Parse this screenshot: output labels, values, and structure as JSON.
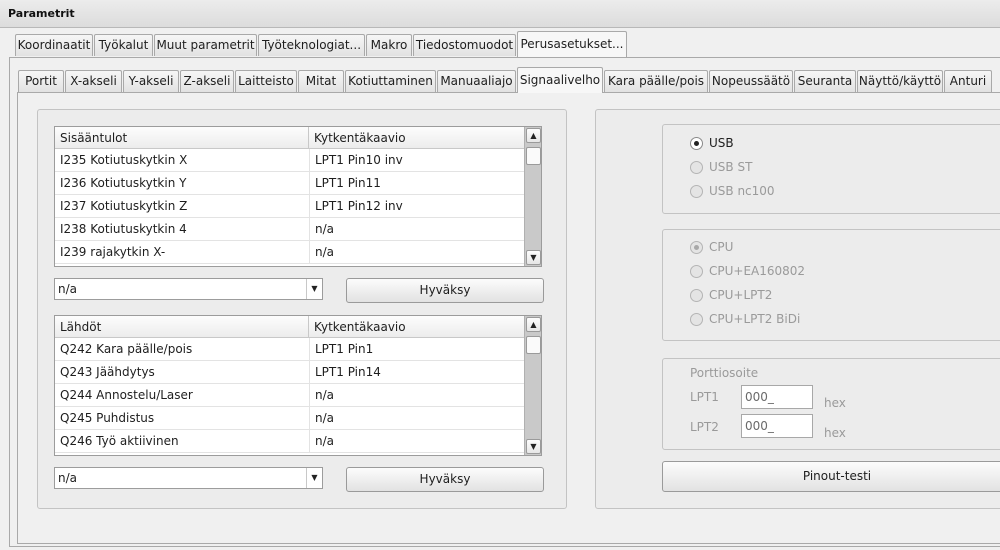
{
  "window": {
    "title": "Parametrit"
  },
  "top_tabs": [
    {
      "label": "Koordinaatit"
    },
    {
      "label": "Työkalut"
    },
    {
      "label": "Muut parametrit"
    },
    {
      "label": "Työteknologiat..."
    },
    {
      "label": "Makro"
    },
    {
      "label": "Tiedostomuodot"
    },
    {
      "label": "Perusasetukset..."
    }
  ],
  "active_top_tab": "Perusasetukset...",
  "sub_tabs": [
    {
      "label": "Portit"
    },
    {
      "label": "X-akseli"
    },
    {
      "label": "Y-akseli"
    },
    {
      "label": "Z-akseli"
    },
    {
      "label": "Laitteisto"
    },
    {
      "label": "Mitat"
    },
    {
      "label": "Kotiuttaminen"
    },
    {
      "label": "Manuaaliajo"
    },
    {
      "label": "Signaalivelho"
    },
    {
      "label": "Kara päälle/pois"
    },
    {
      "label": "Nopeussäätö"
    },
    {
      "label": "Seuranta"
    },
    {
      "label": "Näyttö/käyttö"
    },
    {
      "label": "Anturi"
    }
  ],
  "active_sub_tab": "Signaalivelho",
  "inputs_table": {
    "columns": [
      "Sisääntulot",
      "Kytkentäkaavio"
    ],
    "rows": [
      [
        "I235 Kotiutuskytkin X",
        "LPT1 Pin10 inv"
      ],
      [
        "I236 Kotiutuskytkin Y",
        "LPT1 Pin11"
      ],
      [
        "I237 Kotiutuskytkin Z",
        "LPT1 Pin12 inv"
      ],
      [
        "I238 Kotiutuskytkin 4",
        "n/a"
      ],
      [
        "I239 rajakytkin X-",
        "n/a"
      ]
    ]
  },
  "inputs_combo": {
    "value": "n/a"
  },
  "inputs_accept": {
    "label": "Hyväksy"
  },
  "outputs_table": {
    "columns": [
      "Lähdöt",
      "Kytkentäkaavio"
    ],
    "rows": [
      [
        "Q242 Kara päälle/pois",
        "LPT1 Pin1"
      ],
      [
        "Q243 Jäähdytys",
        "LPT1 Pin14"
      ],
      [
        "Q244 Annostelu/Laser",
        "n/a"
      ],
      [
        "Q245 Puhdistus",
        "n/a"
      ],
      [
        "Q246 Työ aktiivinen",
        "n/a"
      ]
    ]
  },
  "outputs_combo": {
    "value": "n/a"
  },
  "outputs_accept": {
    "label": "Hyväksy"
  },
  "interface_group": {
    "options": [
      {
        "label": "USB",
        "selected": true,
        "enabled": true
      },
      {
        "label": "USB ST",
        "selected": false,
        "enabled": false
      },
      {
        "label": "USB nc100",
        "selected": false,
        "enabled": false
      }
    ]
  },
  "mode_group": {
    "options": [
      {
        "label": "CPU",
        "selected": true,
        "enabled": false
      },
      {
        "label": "CPU+EA160802",
        "selected": false,
        "enabled": false
      },
      {
        "label": "CPU+LPT2",
        "selected": false,
        "enabled": false
      },
      {
        "label": "CPU+LPT2 BiDi",
        "selected": false,
        "enabled": false
      }
    ]
  },
  "port_address": {
    "title": "Porttiosoite",
    "lpt1": {
      "label": "LPT1",
      "value": "000_",
      "unit": "hex"
    },
    "lpt2": {
      "label": "LPT2",
      "value": "000_",
      "unit": "hex"
    }
  },
  "pinout_test": {
    "label": "Pinout-testi"
  }
}
